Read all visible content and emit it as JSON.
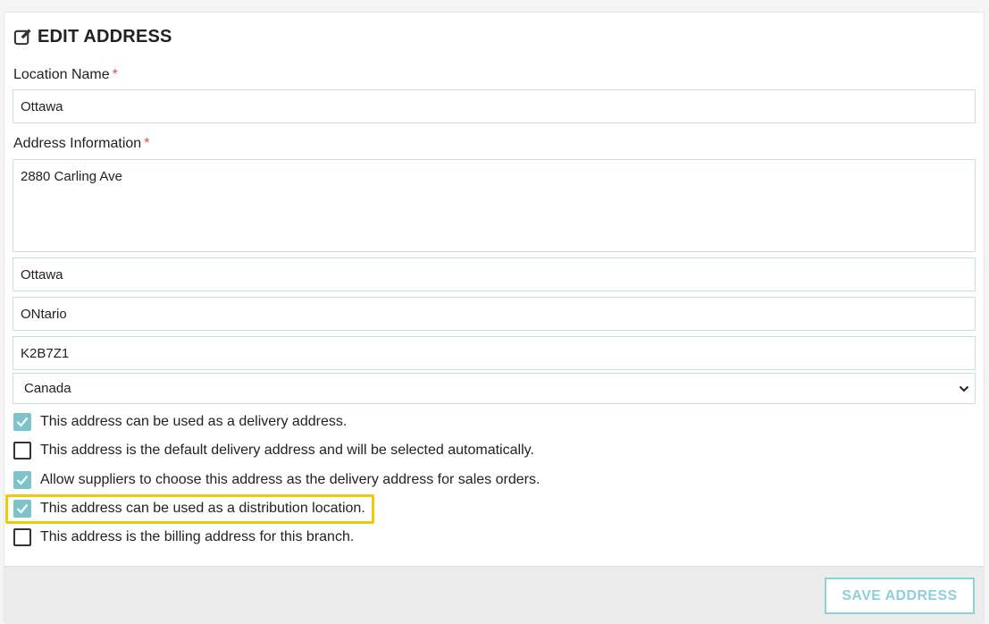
{
  "header": {
    "title": "EDIT ADDRESS",
    "icon": "edit-icon"
  },
  "form": {
    "location_name_label": "Location Name",
    "location_name_value": "Ottawa",
    "address_info_label": "Address Information",
    "required_marker": "*",
    "street": "2880 Carling Ave",
    "city": "Ottawa",
    "province": "ONtario",
    "postal_code": "K2B7Z1",
    "country_selected": "Canada"
  },
  "options": [
    {
      "label": "This address can be used as a delivery address.",
      "checked": true
    },
    {
      "label": "This address is the default delivery address and will be selected automatically.",
      "checked": false
    },
    {
      "label": "Allow suppliers to choose this address as the delivery address for sales orders.",
      "checked": true
    },
    {
      "label": "This address can be used as a distribution location.",
      "checked": true,
      "highlighted": true
    },
    {
      "label": "This address is the billing address for this branch.",
      "checked": false
    }
  ],
  "footer": {
    "save_label": "SAVE ADDRESS"
  },
  "colors": {
    "accent": "#7cc4cc",
    "button_text": "#8fcfd6",
    "required": "#d9534f",
    "highlight": "#f4c70f"
  }
}
